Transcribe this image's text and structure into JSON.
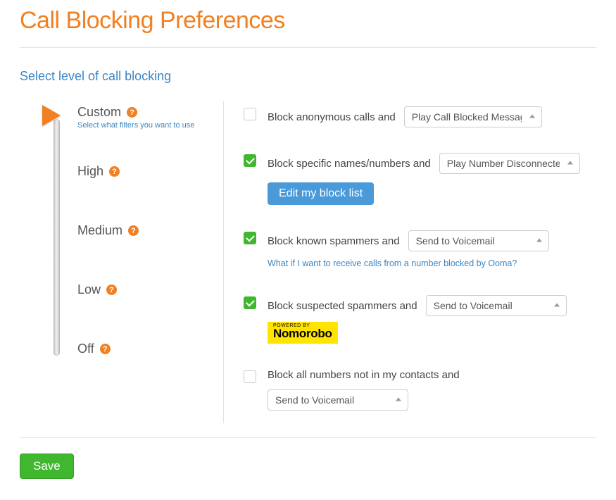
{
  "title": "Call Blocking Preferences",
  "subtitle": "Select level of call blocking",
  "levels": [
    {
      "label": "Custom",
      "desc": "Select what filters you want to use"
    },
    {
      "label": "High",
      "desc": ""
    },
    {
      "label": "Medium",
      "desc": ""
    },
    {
      "label": "Low",
      "desc": ""
    },
    {
      "label": "Off",
      "desc": ""
    }
  ],
  "selected_level_index": 0,
  "filters": {
    "anonymous": {
      "checked": false,
      "label": "Block anonymous calls and",
      "action": "Play Call Blocked Message"
    },
    "specific": {
      "checked": true,
      "label": "Block specific names/numbers and",
      "action": "Play Number Disconnected",
      "edit_button": "Edit my block list"
    },
    "known_spammers": {
      "checked": true,
      "label": "Block known spammers and",
      "action": "Send to Voicemail",
      "help_link": "What if I want to receive calls from a number blocked by Ooma?"
    },
    "suspected_spammers": {
      "checked": true,
      "label": "Block suspected spammers and",
      "action": "Send to Voicemail",
      "badge_powered": "POWERED BY",
      "badge_name": "Nomorobo"
    },
    "not_in_contacts": {
      "checked": false,
      "label": "Block all numbers not in my contacts and",
      "action": "Send to Voicemail"
    }
  },
  "save_label": "Save"
}
